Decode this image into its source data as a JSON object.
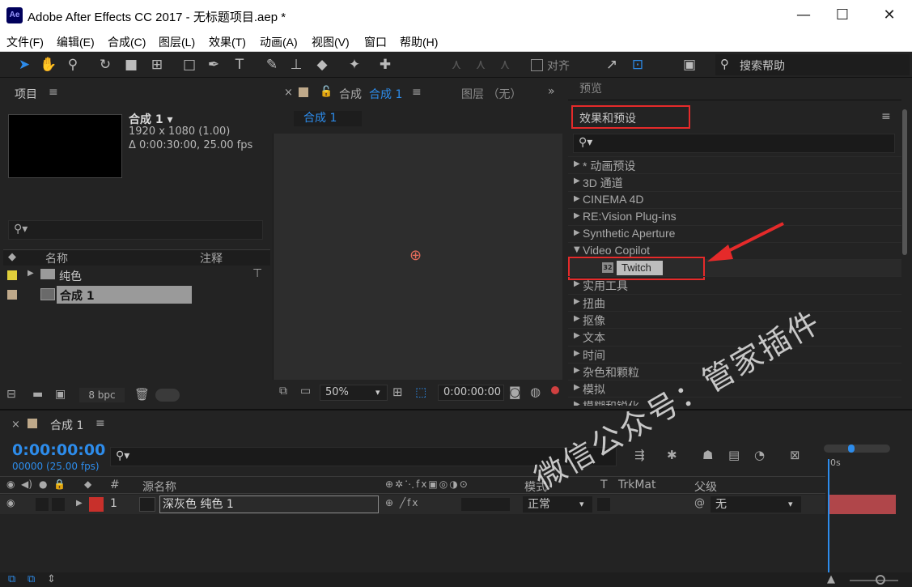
{
  "window": {
    "app_icon": "Ae",
    "title": "Adobe After Effects CC 2017 - 无标题项目.aep *",
    "minimize": "—",
    "maximize": "☐",
    "close": "✕"
  },
  "menu": [
    "文件(F)",
    "编辑(E)",
    "合成(C)",
    "图层(L)",
    "效果(T)",
    "动画(A)",
    "视图(V)",
    "窗口",
    "帮助(H)"
  ],
  "toolbar": {
    "align_label": "对齐",
    "search_help": "搜索帮助"
  },
  "project": {
    "tab_label": "项目",
    "comp_name": "合成 1 ▾",
    "resolution": "1920 x 1080 (1.00)",
    "duration": "Δ 0:00:30:00, 25.00 fps",
    "col_name": "名称",
    "col_comment": "注释",
    "items": [
      {
        "name": "纯色",
        "type": "folder",
        "color": "#e0cf3b"
      },
      {
        "name": "合成 1",
        "type": "comp",
        "color": "#bfa98a"
      }
    ],
    "bpc": "8 bpc"
  },
  "viewer": {
    "tab_close": "×",
    "tab_label": "合成",
    "tab_comp": "合成 1",
    "layer_tab": "图层 （无）",
    "comp_tag": "合成 1",
    "zoom": "50%",
    "timecode": "0:00:00:00"
  },
  "preview": {
    "tab_label": "预览"
  },
  "effects": {
    "tab_label": "效果和预设",
    "categories": [
      {
        "label": "* 动画预设",
        "open": false
      },
      {
        "label": "3D 通道",
        "open": false
      },
      {
        "label": "CINEMA 4D",
        "open": false
      },
      {
        "label": "RE:Vision Plug-ins",
        "open": false
      },
      {
        "label": "Synthetic Aperture",
        "open": false
      },
      {
        "label": "Video Copilot",
        "open": true
      },
      {
        "label": "",
        "open": false
      },
      {
        "label": "实用工具",
        "open": false
      },
      {
        "label": "扭曲",
        "open": false
      },
      {
        "label": "抠像",
        "open": false
      },
      {
        "label": "文本",
        "open": false
      },
      {
        "label": "时间",
        "open": false
      },
      {
        "label": "杂色和颗粒",
        "open": false
      },
      {
        "label": "模拟",
        "open": false
      },
      {
        "label": "模糊和锐化",
        "open": false
      }
    ],
    "plugin_badge": "32",
    "plugin_name": "Twitch",
    "annotation_color": "#e52a2a"
  },
  "timeline": {
    "tab_close": "×",
    "tab_label": "合成 1",
    "timecode": "0:00:00:00",
    "fps": "00000 (25.00 fps)",
    "ruler_label": "0s",
    "headers": {
      "num": "#",
      "source": "源名称",
      "mode": "模式",
      "t": "T",
      "trkmat": "TrkMat",
      "parent": "父级"
    },
    "layer": {
      "index": "1",
      "name": "深灰色 纯色 1",
      "mode": "正常",
      "parent": "无",
      "label_color": "#c8302b"
    }
  },
  "watermark": "微信公众号：管家插件"
}
